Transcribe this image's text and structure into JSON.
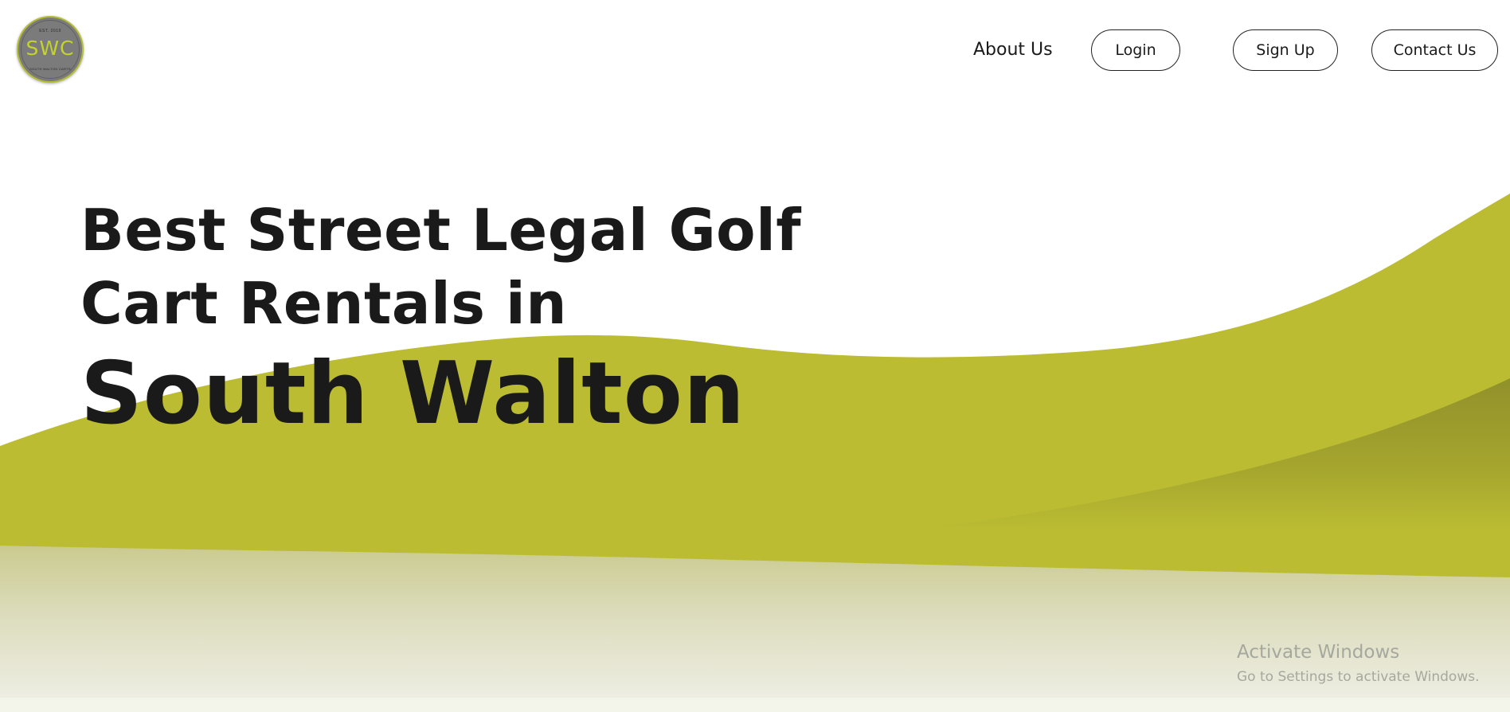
{
  "brand": {
    "logo_top_text": "EST. 2019",
    "logo_text": "SWC",
    "logo_bottom_text": "SOUTH WALTON CARTS",
    "accent_color": "#bbbc32"
  },
  "nav": {
    "about_label": "About Us",
    "login_label": "Login",
    "signup_label": "Sign Up",
    "contact_label": "Contact Us"
  },
  "hero": {
    "line1": "Best Street Legal Golf",
    "line2": "Cart Rentals in",
    "line3": "South Walton"
  },
  "watermark": {
    "title": "Activate Windows",
    "subtitle": "Go to Settings to activate Windows."
  }
}
